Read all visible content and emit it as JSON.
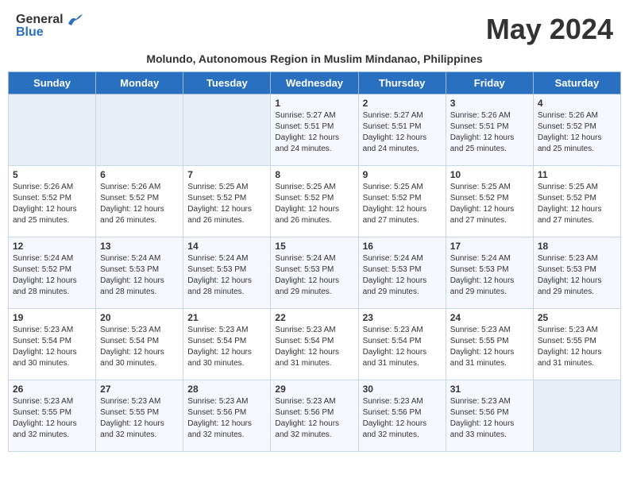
{
  "header": {
    "logo_general": "General",
    "logo_blue": "Blue",
    "month_title": "May 2024",
    "subtitle": "Molundo, Autonomous Region in Muslim Mindanao, Philippines"
  },
  "weekdays": [
    "Sunday",
    "Monday",
    "Tuesday",
    "Wednesday",
    "Thursday",
    "Friday",
    "Saturday"
  ],
  "weeks": [
    [
      {
        "day": "",
        "sunrise": "",
        "sunset": "",
        "daylight": "",
        "empty": true
      },
      {
        "day": "",
        "sunrise": "",
        "sunset": "",
        "daylight": "",
        "empty": true
      },
      {
        "day": "",
        "sunrise": "",
        "sunset": "",
        "daylight": "",
        "empty": true
      },
      {
        "day": "1",
        "sunrise": "Sunrise: 5:27 AM",
        "sunset": "Sunset: 5:51 PM",
        "daylight": "Daylight: 12 hours and 24 minutes."
      },
      {
        "day": "2",
        "sunrise": "Sunrise: 5:27 AM",
        "sunset": "Sunset: 5:51 PM",
        "daylight": "Daylight: 12 hours and 24 minutes."
      },
      {
        "day": "3",
        "sunrise": "Sunrise: 5:26 AM",
        "sunset": "Sunset: 5:51 PM",
        "daylight": "Daylight: 12 hours and 25 minutes."
      },
      {
        "day": "4",
        "sunrise": "Sunrise: 5:26 AM",
        "sunset": "Sunset: 5:52 PM",
        "daylight": "Daylight: 12 hours and 25 minutes."
      }
    ],
    [
      {
        "day": "5",
        "sunrise": "Sunrise: 5:26 AM",
        "sunset": "Sunset: 5:52 PM",
        "daylight": "Daylight: 12 hours and 25 minutes."
      },
      {
        "day": "6",
        "sunrise": "Sunrise: 5:26 AM",
        "sunset": "Sunset: 5:52 PM",
        "daylight": "Daylight: 12 hours and 26 minutes."
      },
      {
        "day": "7",
        "sunrise": "Sunrise: 5:25 AM",
        "sunset": "Sunset: 5:52 PM",
        "daylight": "Daylight: 12 hours and 26 minutes."
      },
      {
        "day": "8",
        "sunrise": "Sunrise: 5:25 AM",
        "sunset": "Sunset: 5:52 PM",
        "daylight": "Daylight: 12 hours and 26 minutes."
      },
      {
        "day": "9",
        "sunrise": "Sunrise: 5:25 AM",
        "sunset": "Sunset: 5:52 PM",
        "daylight": "Daylight: 12 hours and 27 minutes."
      },
      {
        "day": "10",
        "sunrise": "Sunrise: 5:25 AM",
        "sunset": "Sunset: 5:52 PM",
        "daylight": "Daylight: 12 hours and 27 minutes."
      },
      {
        "day": "11",
        "sunrise": "Sunrise: 5:25 AM",
        "sunset": "Sunset: 5:52 PM",
        "daylight": "Daylight: 12 hours and 27 minutes."
      }
    ],
    [
      {
        "day": "12",
        "sunrise": "Sunrise: 5:24 AM",
        "sunset": "Sunset: 5:52 PM",
        "daylight": "Daylight: 12 hours and 28 minutes."
      },
      {
        "day": "13",
        "sunrise": "Sunrise: 5:24 AM",
        "sunset": "Sunset: 5:53 PM",
        "daylight": "Daylight: 12 hours and 28 minutes."
      },
      {
        "day": "14",
        "sunrise": "Sunrise: 5:24 AM",
        "sunset": "Sunset: 5:53 PM",
        "daylight": "Daylight: 12 hours and 28 minutes."
      },
      {
        "day": "15",
        "sunrise": "Sunrise: 5:24 AM",
        "sunset": "Sunset: 5:53 PM",
        "daylight": "Daylight: 12 hours and 29 minutes."
      },
      {
        "day": "16",
        "sunrise": "Sunrise: 5:24 AM",
        "sunset": "Sunset: 5:53 PM",
        "daylight": "Daylight: 12 hours and 29 minutes."
      },
      {
        "day": "17",
        "sunrise": "Sunrise: 5:24 AM",
        "sunset": "Sunset: 5:53 PM",
        "daylight": "Daylight: 12 hours and 29 minutes."
      },
      {
        "day": "18",
        "sunrise": "Sunrise: 5:23 AM",
        "sunset": "Sunset: 5:53 PM",
        "daylight": "Daylight: 12 hours and 29 minutes."
      }
    ],
    [
      {
        "day": "19",
        "sunrise": "Sunrise: 5:23 AM",
        "sunset": "Sunset: 5:54 PM",
        "daylight": "Daylight: 12 hours and 30 minutes."
      },
      {
        "day": "20",
        "sunrise": "Sunrise: 5:23 AM",
        "sunset": "Sunset: 5:54 PM",
        "daylight": "Daylight: 12 hours and 30 minutes."
      },
      {
        "day": "21",
        "sunrise": "Sunrise: 5:23 AM",
        "sunset": "Sunset: 5:54 PM",
        "daylight": "Daylight: 12 hours and 30 minutes."
      },
      {
        "day": "22",
        "sunrise": "Sunrise: 5:23 AM",
        "sunset": "Sunset: 5:54 PM",
        "daylight": "Daylight: 12 hours and 31 minutes."
      },
      {
        "day": "23",
        "sunrise": "Sunrise: 5:23 AM",
        "sunset": "Sunset: 5:54 PM",
        "daylight": "Daylight: 12 hours and 31 minutes."
      },
      {
        "day": "24",
        "sunrise": "Sunrise: 5:23 AM",
        "sunset": "Sunset: 5:55 PM",
        "daylight": "Daylight: 12 hours and 31 minutes."
      },
      {
        "day": "25",
        "sunrise": "Sunrise: 5:23 AM",
        "sunset": "Sunset: 5:55 PM",
        "daylight": "Daylight: 12 hours and 31 minutes."
      }
    ],
    [
      {
        "day": "26",
        "sunrise": "Sunrise: 5:23 AM",
        "sunset": "Sunset: 5:55 PM",
        "daylight": "Daylight: 12 hours and 32 minutes."
      },
      {
        "day": "27",
        "sunrise": "Sunrise: 5:23 AM",
        "sunset": "Sunset: 5:55 PM",
        "daylight": "Daylight: 12 hours and 32 minutes."
      },
      {
        "day": "28",
        "sunrise": "Sunrise: 5:23 AM",
        "sunset": "Sunset: 5:56 PM",
        "daylight": "Daylight: 12 hours and 32 minutes."
      },
      {
        "day": "29",
        "sunrise": "Sunrise: 5:23 AM",
        "sunset": "Sunset: 5:56 PM",
        "daylight": "Daylight: 12 hours and 32 minutes."
      },
      {
        "day": "30",
        "sunrise": "Sunrise: 5:23 AM",
        "sunset": "Sunset: 5:56 PM",
        "daylight": "Daylight: 12 hours and 32 minutes."
      },
      {
        "day": "31",
        "sunrise": "Sunrise: 5:23 AM",
        "sunset": "Sunset: 5:56 PM",
        "daylight": "Daylight: 12 hours and 33 minutes."
      },
      {
        "day": "",
        "sunrise": "",
        "sunset": "",
        "daylight": "",
        "empty": true
      }
    ]
  ]
}
